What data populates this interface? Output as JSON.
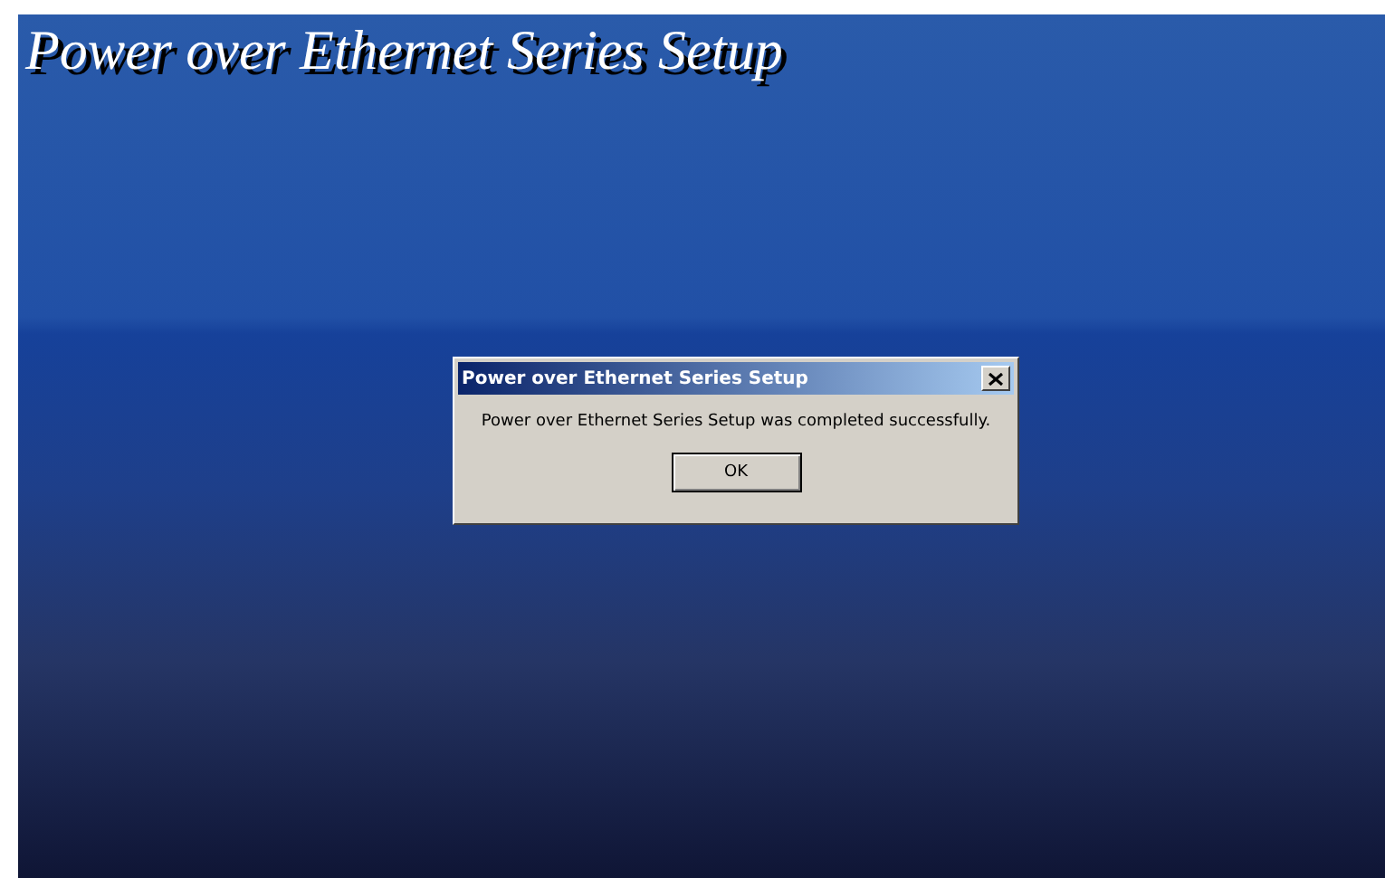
{
  "installer": {
    "title": "Power over Ethernet Series Setup"
  },
  "dialog": {
    "title": "Power over Ethernet Series Setup",
    "message": "Power over Ethernet Series Setup was completed successfully.",
    "buttons": [
      "OK"
    ]
  }
}
